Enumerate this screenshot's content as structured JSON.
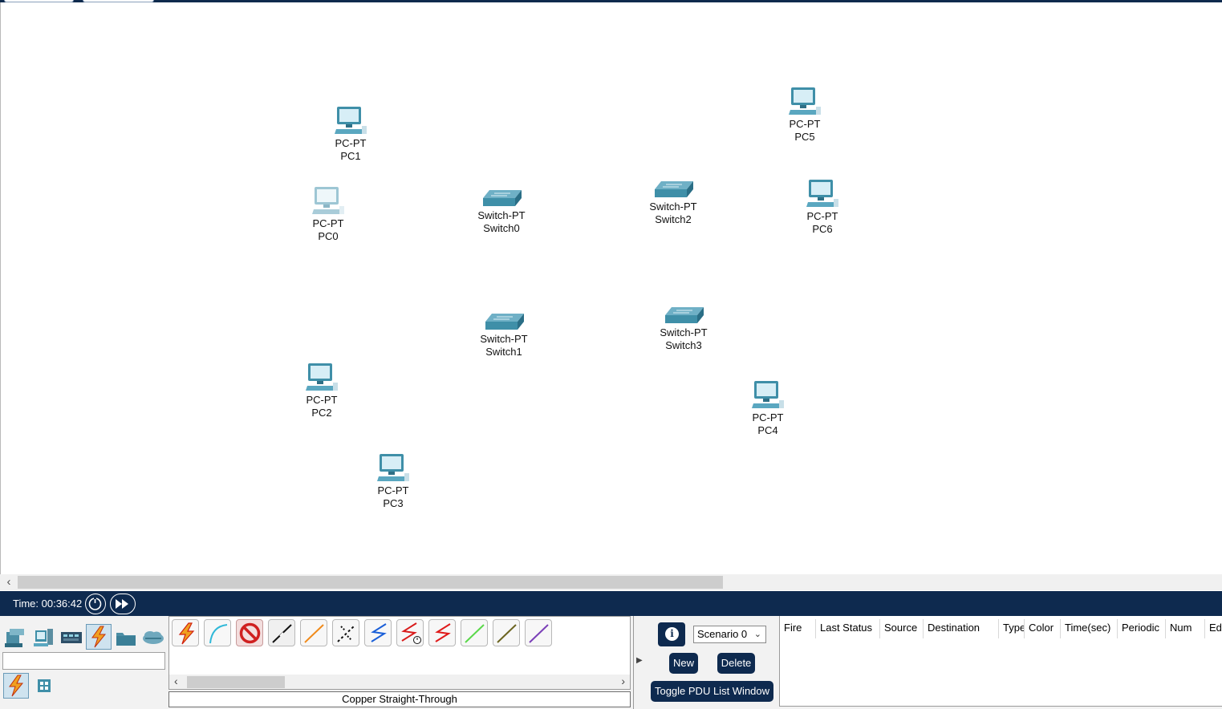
{
  "workspace": {
    "devices": [
      {
        "id": "pc1",
        "model": "PC-PT",
        "name": "PC1",
        "kind": "pc"
      },
      {
        "id": "pc0",
        "model": "PC-PT",
        "name": "PC0",
        "kind": "pc-faded"
      },
      {
        "id": "switch0",
        "model": "Switch-PT",
        "name": "Switch0",
        "kind": "switch"
      },
      {
        "id": "switch2",
        "model": "Switch-PT",
        "name": "Switch2",
        "kind": "switch"
      },
      {
        "id": "pc5",
        "model": "PC-PT",
        "name": "PC5",
        "kind": "pc"
      },
      {
        "id": "pc6",
        "model": "PC-PT",
        "name": "PC6",
        "kind": "pc"
      },
      {
        "id": "switch1",
        "model": "Switch-PT",
        "name": "Switch1",
        "kind": "switch"
      },
      {
        "id": "switch3",
        "model": "Switch-PT",
        "name": "Switch3",
        "kind": "switch"
      },
      {
        "id": "pc2",
        "model": "PC-PT",
        "name": "PC2",
        "kind": "pc"
      },
      {
        "id": "pc4",
        "model": "PC-PT",
        "name": "PC4",
        "kind": "pc"
      },
      {
        "id": "pc3",
        "model": "PC-PT",
        "name": "PC3",
        "kind": "pc"
      }
    ]
  },
  "timebar": {
    "time_label": "Time: 00:36:42",
    "buttons": [
      "power-cycle-icon",
      "fast-forward-icon"
    ]
  },
  "device_panel": {
    "categories": [
      "network-devices-icon",
      "end-devices-icon",
      "components-icon",
      "connections-icon",
      "miscellaneous-icon",
      "multiuser-icon"
    ],
    "selected_category": "connections-icon",
    "search_value": "",
    "subcategories": [
      "connections-icon",
      "grid-icon"
    ]
  },
  "connections": {
    "items": [
      {
        "icon": "automatic-connection-icon",
        "color": "#e8a020"
      },
      {
        "icon": "console-cable-icon",
        "color": "#2fb8d8"
      },
      {
        "icon": "no-connection-icon",
        "color": "#d02020"
      },
      {
        "icon": "copper-straight-through-icon",
        "color": "#111111"
      },
      {
        "icon": "copper-cross-over-icon",
        "color": "#f08a1a"
      },
      {
        "icon": "fiber-icon",
        "color": "#111111"
      },
      {
        "icon": "phone-cable-icon",
        "color": "#1a5fd8"
      },
      {
        "icon": "coaxial-clock-icon",
        "color": "#d81a1a"
      },
      {
        "icon": "serial-dce-icon",
        "color": "#e01a1a"
      },
      {
        "icon": "octal-cable-icon",
        "color": "#5ad84a"
      },
      {
        "icon": "iot-custom-cable-icon",
        "color": "#6b6420"
      },
      {
        "icon": "usb-cable-icon",
        "color": "#7a3fb8"
      }
    ],
    "selected_name": "Copper Straight-Through"
  },
  "scenario": {
    "selected": "Scenario 0",
    "new_label": "New",
    "delete_label": "Delete",
    "toggle_label": "Toggle PDU List Window"
  },
  "pdu_table": {
    "columns": [
      "Fire",
      "Last Status",
      "Source",
      "Destination",
      "Type",
      "Color",
      "Time(sec)",
      "Periodic",
      "Num",
      "Ed"
    ]
  },
  "colors": {
    "dark_navy": "#0e2a4f",
    "device_teal": "#3f8fa8"
  }
}
